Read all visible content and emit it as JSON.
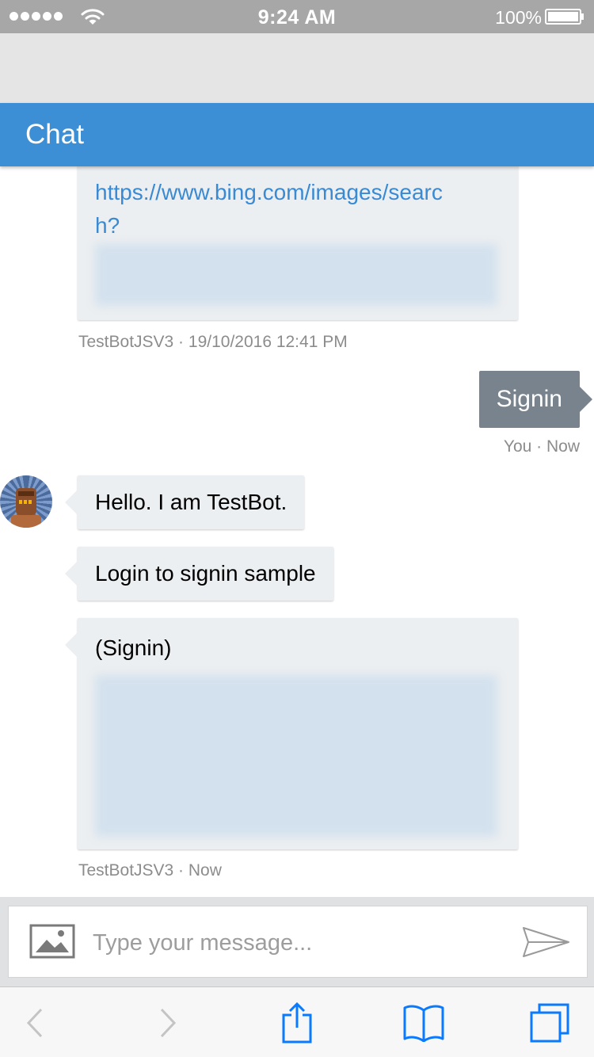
{
  "status_bar": {
    "time": "9:24 AM",
    "battery": "100%",
    "icons": [
      "signal-dots-icon",
      "wifi-icon",
      "battery-icon"
    ]
  },
  "header": {
    "title": "Chat"
  },
  "messages": {
    "card1": {
      "link_line1": "https://www.bing.com/images/searc",
      "link_line2": "h?",
      "meta": "TestBotJSV3 · 19/10/2016 12:41 PM"
    },
    "outgoing": {
      "text": "Signin",
      "meta": "You · Now"
    },
    "incoming1": {
      "text": "Hello. I am TestBot."
    },
    "incoming2": {
      "text": "Login to signin sample"
    },
    "card2": {
      "title": "(Signin)",
      "meta": "TestBotJSV3 · Now"
    }
  },
  "composer": {
    "placeholder": "Type your message...",
    "value": "",
    "icons": [
      "image-icon",
      "send-icon"
    ]
  },
  "toolbar": {
    "icons": [
      "back-icon",
      "forward-icon",
      "share-icon",
      "bookmarks-icon",
      "tabs-icon"
    ]
  },
  "colors": {
    "header": "#3d8fd5",
    "link": "#3a8ad3",
    "outgoing_bubble": "#78838d",
    "incoming_bubble": "#eceff1",
    "ios_blue": "#0a7bff",
    "status_bar": "#a7a7a7"
  }
}
